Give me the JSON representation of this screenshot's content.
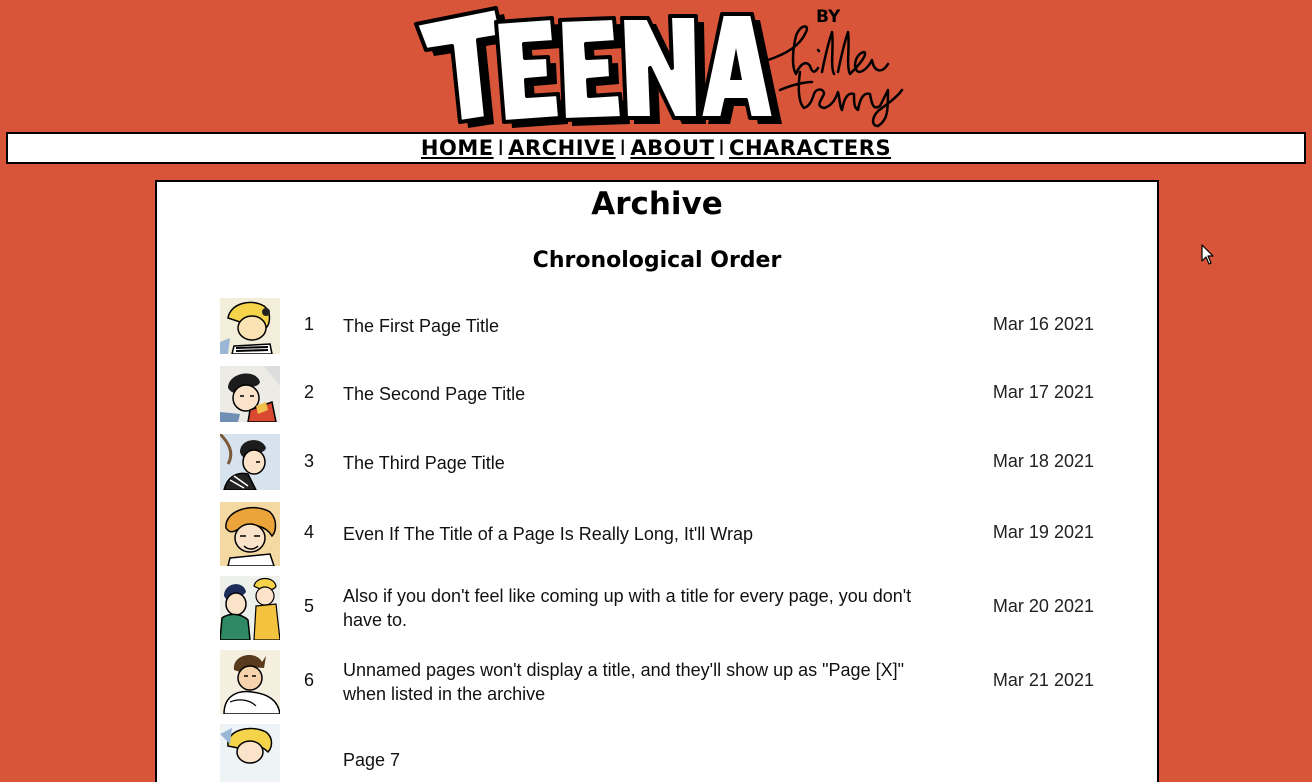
{
  "header": {
    "logo_text": "TEENA",
    "byline_by": "BY",
    "byline_name": "hilda terry"
  },
  "nav": {
    "items": [
      "HOME",
      "ARCHIVE",
      "ABOUT",
      "CHARACTERS"
    ],
    "separator": "I"
  },
  "main": {
    "title": "Archive",
    "section_title": "Chronological Order",
    "pages": [
      {
        "number": "1",
        "title": "The First Page Title",
        "date": "Mar 16 2021"
      },
      {
        "number": "2",
        "title": "The Second Page Title",
        "date": "Mar 17 2021"
      },
      {
        "number": "3",
        "title": "The Third Page Title",
        "date": "Mar 18 2021"
      },
      {
        "number": "4",
        "title": "Even If The Title of a Page Is Really Long, It'll Wrap",
        "date": "Mar 19 2021"
      },
      {
        "number": "5",
        "title": "Also if you don't feel like coming up with a title for every page, you don't have to.",
        "date": "Mar 20 2021"
      },
      {
        "number": "6",
        "title": "Unnamed pages won't display a title, and they'll show up as \"Page [X]\" when listed in the archive",
        "date": "Mar 21 2021"
      },
      {
        "number": "",
        "title": "Page 7",
        "date": ""
      }
    ]
  },
  "colors": {
    "background": "#d9553a",
    "panel": "#ffffff",
    "border": "#000000"
  },
  "icons": [
    "mouse-cursor-icon"
  ]
}
